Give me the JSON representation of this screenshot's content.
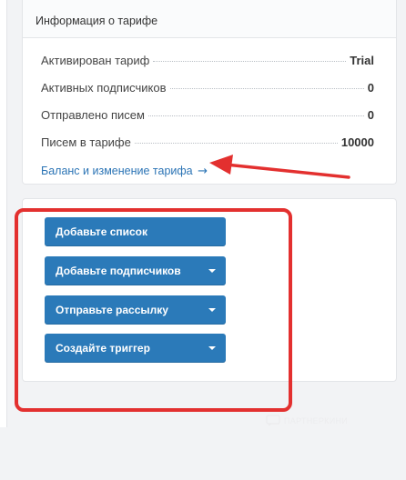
{
  "tariff": {
    "heading": "Информация о тарифе",
    "rows": [
      {
        "label": "Активирован тариф",
        "value": "Trial"
      },
      {
        "label": "Активных подписчиков",
        "value": "0"
      },
      {
        "label": "Отправлено писем",
        "value": "0"
      },
      {
        "label": "Писем в тарифе",
        "value": "10000"
      }
    ],
    "balance_link": "Баланс и изменение тарифа",
    "balance_arrow": "→"
  },
  "actions": {
    "add_list": "Добавьте список",
    "add_subscribers": "Добавьте подписчиков",
    "send_campaign": "Отправьте рассылку",
    "create_trigger": "Создайте триггер"
  },
  "annotations": {
    "color": "#e3302f"
  },
  "icons": {
    "dropdown": "chevron-down-icon",
    "watermark": "chat-icon"
  },
  "watermark_text": "ПАРТНЕРКИНИ",
  "colors": {
    "button": "#2b7ab9",
    "link": "#2b74b5",
    "background": "#f2f3f5"
  }
}
